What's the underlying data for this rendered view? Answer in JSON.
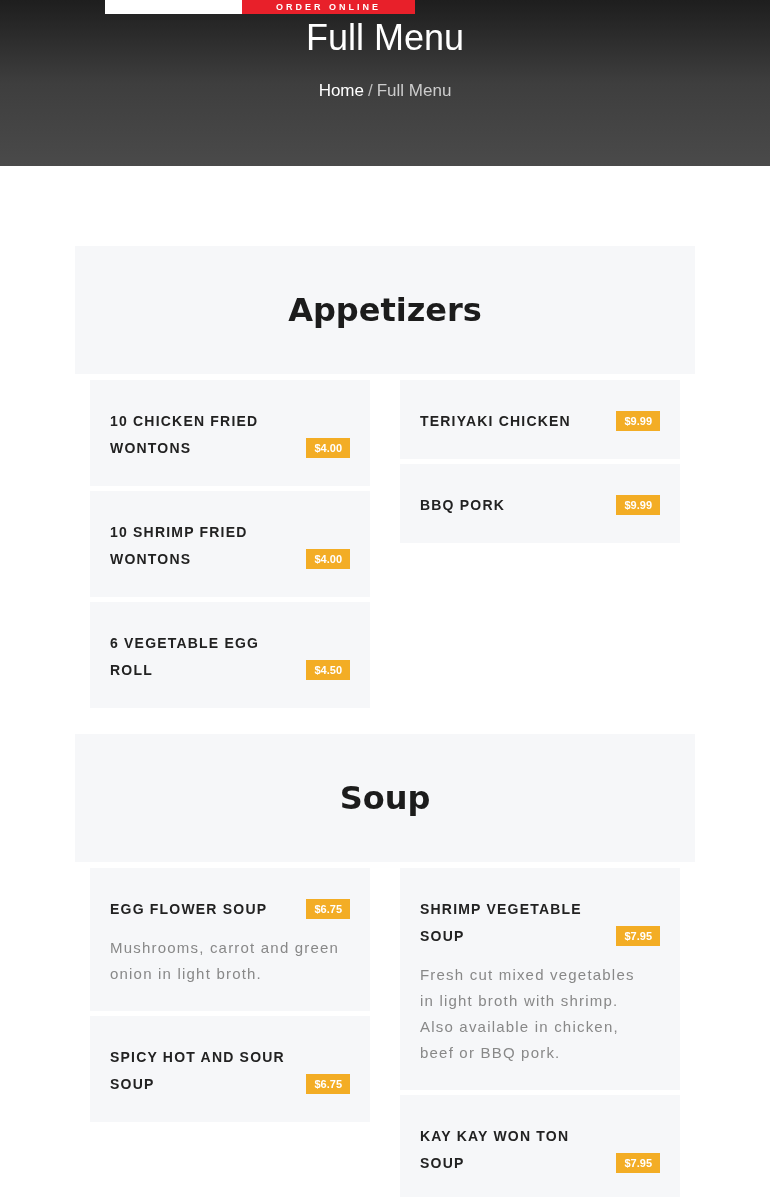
{
  "header": {
    "order_button": "ORDER ONLINE"
  },
  "hero": {
    "title": "Full Menu",
    "breadcrumb": [
      {
        "label": "Home",
        "current": false
      },
      {
        "label": "Full Menu",
        "current": true
      }
    ],
    "separator": "/"
  },
  "sections": [
    {
      "title": "Appetizers",
      "columns": [
        [
          {
            "name": "10 CHICKEN FRIED WONTONS",
            "price": "$4.00"
          },
          {
            "name": "10 SHRIMP FRIED WONTONS",
            "price": "$4.00"
          },
          {
            "name": "6 VEGETABLE EGG ROLL",
            "price": "$4.50"
          }
        ],
        [
          {
            "name": "TERIYAKI CHICKEN",
            "price": "$9.99"
          },
          {
            "name": "BBQ PORK",
            "price": "$9.99"
          }
        ]
      ]
    },
    {
      "title": "Soup",
      "columns": [
        [
          {
            "name": "EGG FLOWER SOUP",
            "price": "$6.75",
            "description": "Mushrooms, carrot and green onion in light broth."
          },
          {
            "name": "SPICY HOT AND SOUR SOUP",
            "price": "$6.75"
          }
        ],
        [
          {
            "name": "SHRIMP VEGETABLE SOUP",
            "price": "$7.95",
            "description": "Fresh cut mixed vegetables in light broth with shrimp. Also available in chicken, beef or BBQ pork."
          },
          {
            "name": "KAY KAY WON TON SOUP",
            "price": "$7.95"
          }
        ]
      ]
    }
  ]
}
